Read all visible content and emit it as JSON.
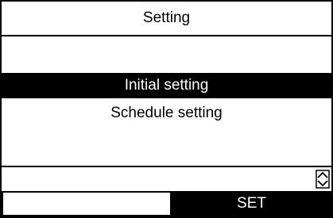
{
  "screen": {
    "title": "Setting"
  },
  "menu": {
    "items": [
      {
        "label": "Initial setting",
        "selected": true
      },
      {
        "label": "Schedule setting",
        "selected": false
      }
    ]
  },
  "status": {
    "scroll_icon": "scroll-up-down-icon"
  },
  "softkeys": {
    "left_label": "",
    "right_label": "SET"
  },
  "colors": {
    "foreground": "#000000",
    "background": "#ffffff",
    "highlight": "#000000",
    "highlight_text": "#ffffff"
  }
}
